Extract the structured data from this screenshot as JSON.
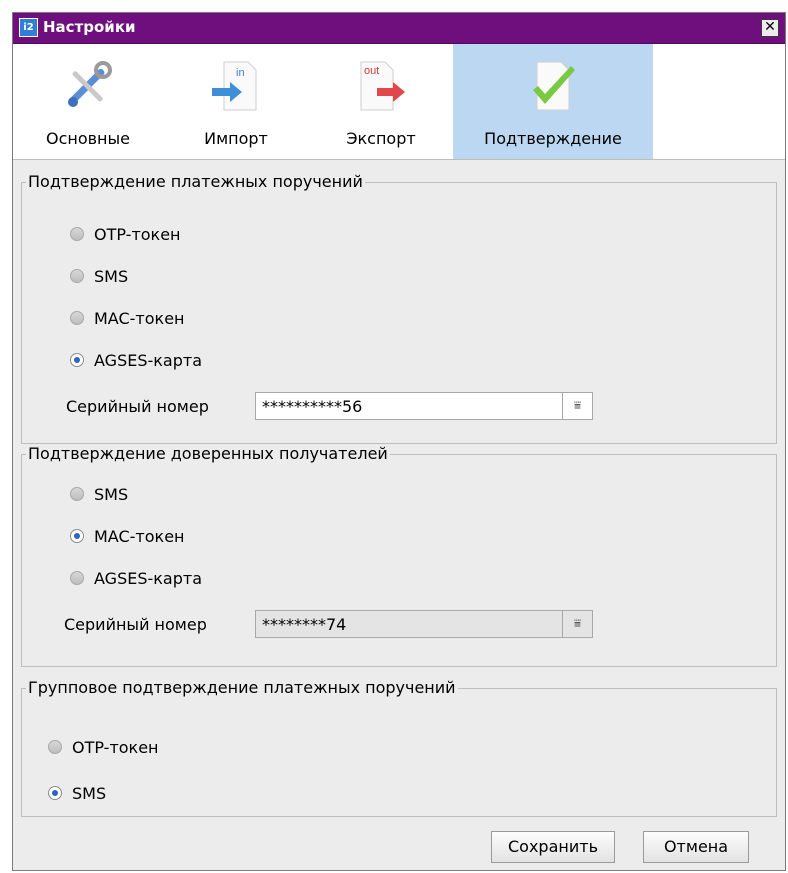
{
  "window": {
    "title": "Настройки",
    "app_icon_text": "i2",
    "close_glyph": "✕"
  },
  "tabs": [
    {
      "label": "Основные",
      "icon": "tools-icon",
      "active": false
    },
    {
      "label": "Импорт",
      "icon": "import-icon",
      "badge": "in",
      "active": false
    },
    {
      "label": "Экспорт",
      "icon": "export-icon",
      "badge": "out",
      "active": false
    },
    {
      "label": "Подтверждение",
      "icon": "confirm-check-icon",
      "active": true
    }
  ],
  "payment_confirmation": {
    "legend": "Подтверждение платежных поручений",
    "options": [
      {
        "label": "OTP-токен",
        "checked": false
      },
      {
        "label": "SMS",
        "checked": false
      },
      {
        "label": "MAC-токен",
        "checked": false
      },
      {
        "label": "AGSES-карта",
        "checked": true
      }
    ],
    "serial_label": "Серийный номер",
    "serial_value": "**********56",
    "combo_enabled": true
  },
  "trusted_recipients": {
    "legend": "Подтверждение доверенных получателей",
    "options": [
      {
        "label": "SMS",
        "checked": false
      },
      {
        "label": "MAC-токен",
        "checked": true
      },
      {
        "label": "AGSES-карта",
        "checked": false
      }
    ],
    "serial_label": "Серийный номер",
    "serial_value": "********74",
    "combo_enabled": false
  },
  "group_confirmation": {
    "legend": "Групповое подтверждение платежных поручений",
    "options": [
      {
        "label": "OTP-токен",
        "checked": false
      },
      {
        "label": "SMS",
        "checked": true
      }
    ]
  },
  "buttons": {
    "save": "Сохранить",
    "cancel": "Отмена"
  },
  "colors": {
    "titlebar": "#6e0f7d",
    "active_tab": "#bcd7f2",
    "radio_dot": "#2d63c8"
  },
  "combo_arrow_glyph": "⩸"
}
